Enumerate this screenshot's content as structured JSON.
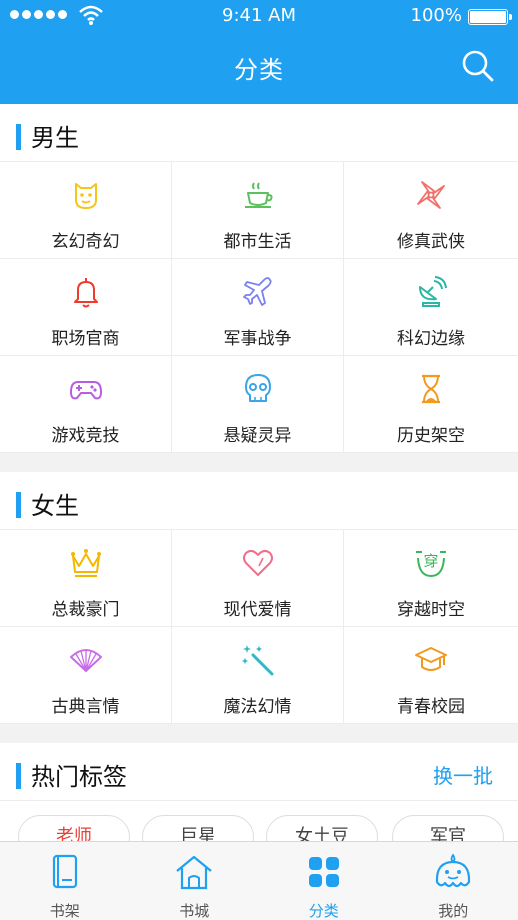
{
  "status_bar": {
    "time": "9:41 AM",
    "battery": "100%"
  },
  "nav": {
    "title": "分类"
  },
  "male": {
    "title": "男生",
    "items": [
      {
        "label": "玄幻奇幻",
        "icon": "monster-face-icon",
        "color": "#f5c518"
      },
      {
        "label": "都市生活",
        "icon": "coffee-cup-icon",
        "color": "#5cc05c"
      },
      {
        "label": "修真武侠",
        "icon": "shuriken-icon",
        "color": "#f2706a"
      },
      {
        "label": "职场官商",
        "icon": "bell-icon",
        "color": "#f03a2e"
      },
      {
        "label": "军事战争",
        "icon": "airplane-icon",
        "color": "#7b7ff0"
      },
      {
        "label": "科幻边缘",
        "icon": "satellite-dish-icon",
        "color": "#2ab7a3"
      },
      {
        "label": "游戏竞技",
        "icon": "gamepad-icon",
        "color": "#b75ee0"
      },
      {
        "label": "悬疑灵异",
        "icon": "skull-icon",
        "color": "#3aa6e8"
      },
      {
        "label": "历史架空",
        "icon": "hourglass-icon",
        "color": "#f29a1e"
      }
    ]
  },
  "female": {
    "title": "女生",
    "items": [
      {
        "label": "总裁豪门",
        "icon": "crown-icon",
        "color": "#f5b800"
      },
      {
        "label": "现代爱情",
        "icon": "heart-icon",
        "color": "#ef6f8a"
      },
      {
        "label": "穿越时空",
        "icon": "chuan-badge-icon",
        "badge": "穿",
        "color": "#3bb55a"
      },
      {
        "label": "古典言情",
        "icon": "folding-fan-icon",
        "color": "#c76de8"
      },
      {
        "label": "魔法幻情",
        "icon": "magic-wand-icon",
        "color": "#2fb8c8"
      },
      {
        "label": "青春校园",
        "icon": "graduation-cap-icon",
        "color": "#f29a1e"
      }
    ]
  },
  "hot_tags": {
    "title": "热门标签",
    "more_label": "换一批",
    "tags": [
      "老师",
      "巨星",
      "女土豆",
      "军官"
    ]
  },
  "tabbar": {
    "items": [
      {
        "label": "书架",
        "icon": "bookshelf-icon",
        "active": false
      },
      {
        "label": "书城",
        "icon": "bookstore-house-icon",
        "active": false
      },
      {
        "label": "分类",
        "icon": "category-grid-icon",
        "active": true
      },
      {
        "label": "我的",
        "icon": "profile-mascot-icon",
        "active": false
      }
    ]
  },
  "colors": {
    "accent": "#1fa0f0"
  }
}
